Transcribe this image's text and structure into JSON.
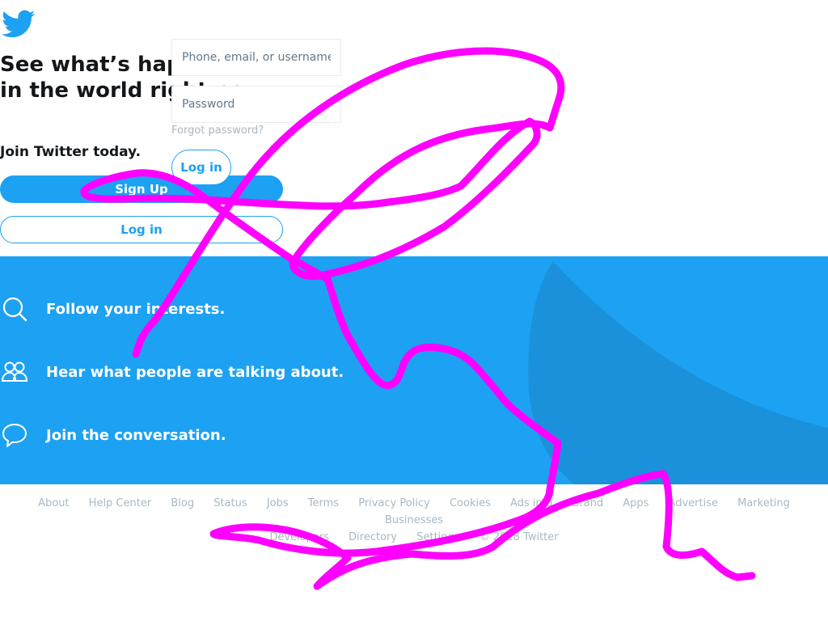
{
  "brand": {
    "logo_icon": "twitter-bird-icon",
    "color": "#1da1f2"
  },
  "hero": {
    "headline_line1": "See what’s happening",
    "headline_line2": "in the world right now",
    "join_text": "Join Twitter today.",
    "signup_label": "Sign Up",
    "login_label": "Log in"
  },
  "login_form": {
    "username_placeholder": "Phone, email, or username",
    "password_placeholder": "Password",
    "forgot_label": "Forgot password?",
    "login_label": "Log in"
  },
  "features": [
    {
      "icon": "search-icon",
      "text": "Follow your interests."
    },
    {
      "icon": "people-icon",
      "text": "Hear what people are talking about."
    },
    {
      "icon": "speech-bubble-icon",
      "text": "Join the conversation."
    }
  ],
  "footer": {
    "row1": [
      "About",
      "Help Center",
      "Blog",
      "Status",
      "Jobs",
      "Terms",
      "Privacy Policy",
      "Cookies",
      "Ads info",
      "Brand",
      "Apps",
      "Advertise",
      "Marketing",
      "Businesses"
    ],
    "row2": [
      "Developers",
      "Directory",
      "Settings",
      "© 2018 Twitter"
    ]
  },
  "annotation": {
    "color": "#ff00ff"
  }
}
